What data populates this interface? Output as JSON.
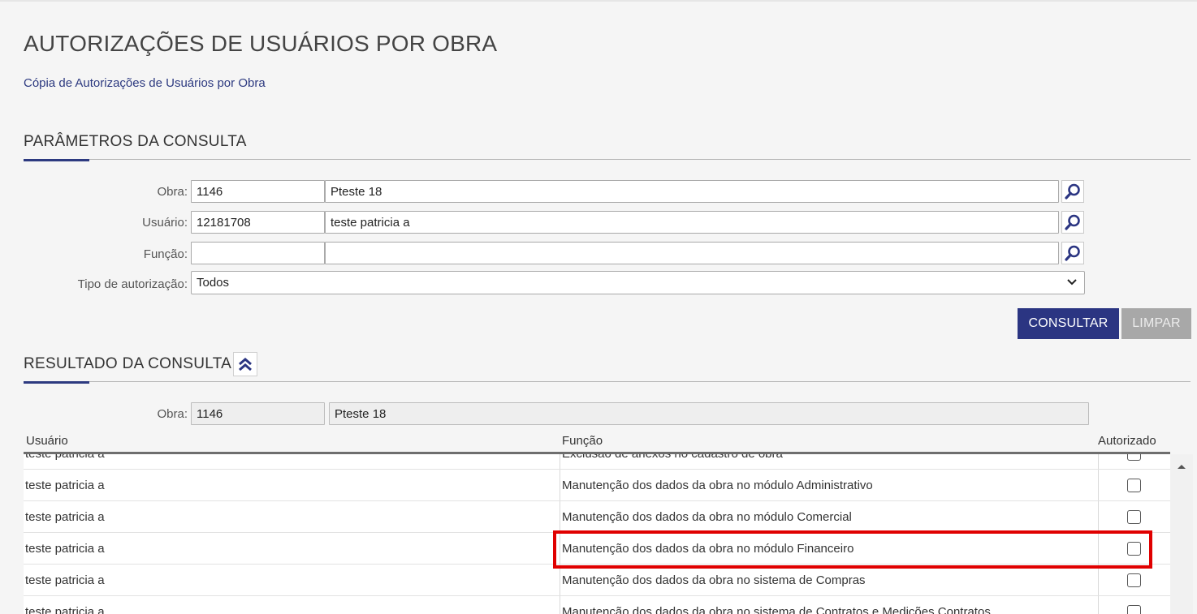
{
  "page": {
    "title": "AUTORIZAÇÕES DE USUÁRIOS POR OBRA",
    "sub_link": "Cópia de Autorizações de Usuários por Obra"
  },
  "params": {
    "section_title": "PARÂMETROS DA CONSULTA",
    "obra_label": "Obra:",
    "obra_code": "1146",
    "obra_name": "Pteste 18",
    "usuario_label": "Usuário:",
    "usuario_code": "12181708",
    "usuario_name": "teste patricia a",
    "funcao_label": "Função:",
    "funcao_code": "",
    "funcao_name": "",
    "tipo_label": "Tipo de autorização:",
    "tipo_value": "Todos",
    "consultar_label": "CONSULTAR",
    "limpar_label": "LIMPAR"
  },
  "result": {
    "section_title": "RESULTADO DA CONSULTA",
    "obra_label": "Obra:",
    "obra_code": "1146",
    "obra_name": "Pteste 18",
    "columns": [
      "Usuário",
      "Função",
      "Autorizado"
    ],
    "rows": [
      {
        "usuario": "teste patricia a",
        "funcao": "Exclusão de anexos no cadastro de obra",
        "autorizado": false
      },
      {
        "usuario": "teste patricia a",
        "funcao": "Manutenção dos dados da obra no módulo Administrativo",
        "autorizado": false
      },
      {
        "usuario": "teste patricia a",
        "funcao": "Manutenção dos dados da obra no módulo Comercial",
        "autorizado": false
      },
      {
        "usuario": "teste patricia a",
        "funcao": "Manutenção dos dados da obra no módulo Financeiro",
        "autorizado": false
      },
      {
        "usuario": "teste patricia a",
        "funcao": "Manutenção dos dados da obra no sistema de Compras",
        "autorizado": false
      },
      {
        "usuario": "teste patricia a",
        "funcao": "Manutenção dos dados da obra no sistema de Contratos e Medições Contratos",
        "autorizado": false
      }
    ]
  },
  "colors": {
    "primary": "#2b3582",
    "link": "#2d3a80",
    "highlight": "#e00000",
    "disabled": "#a8a8a8"
  },
  "icons": {
    "search": "search-icon",
    "collapse": "double-chevron-up-icon",
    "dropdown": "chevron-down-icon",
    "scroll_up": "scroll-up-arrow-icon"
  }
}
